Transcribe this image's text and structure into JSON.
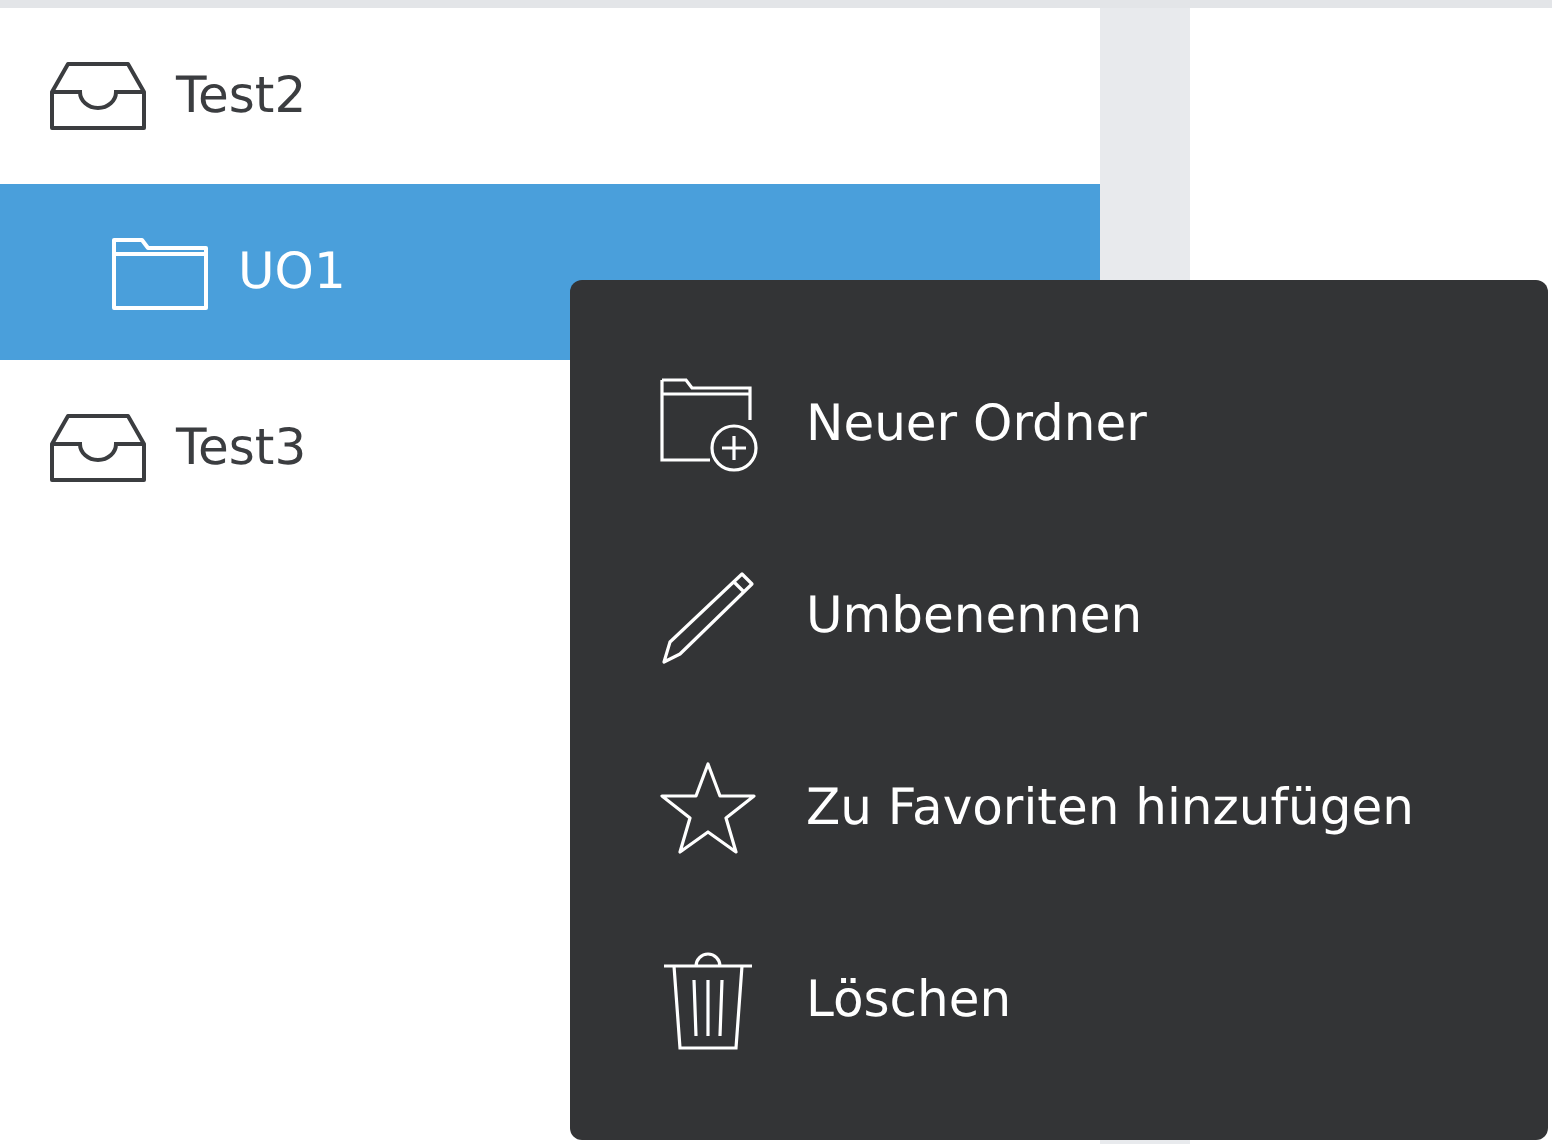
{
  "tree": [
    {
      "label": "Test2",
      "kind": "inbox",
      "selected": false,
      "children": [
        {
          "label": "UO1",
          "kind": "folder",
          "selected": true
        }
      ]
    },
    {
      "label": "Test3",
      "kind": "inbox",
      "selected": false
    }
  ],
  "context_menu": [
    {
      "label": "Neuer Ordner",
      "kind": "new-folder"
    },
    {
      "label": "Umbenennen",
      "kind": "rename"
    },
    {
      "label": "Zu Favoriten hinzufügen",
      "kind": "favorite"
    },
    {
      "label": "Löschen",
      "kind": "delete"
    }
  ]
}
